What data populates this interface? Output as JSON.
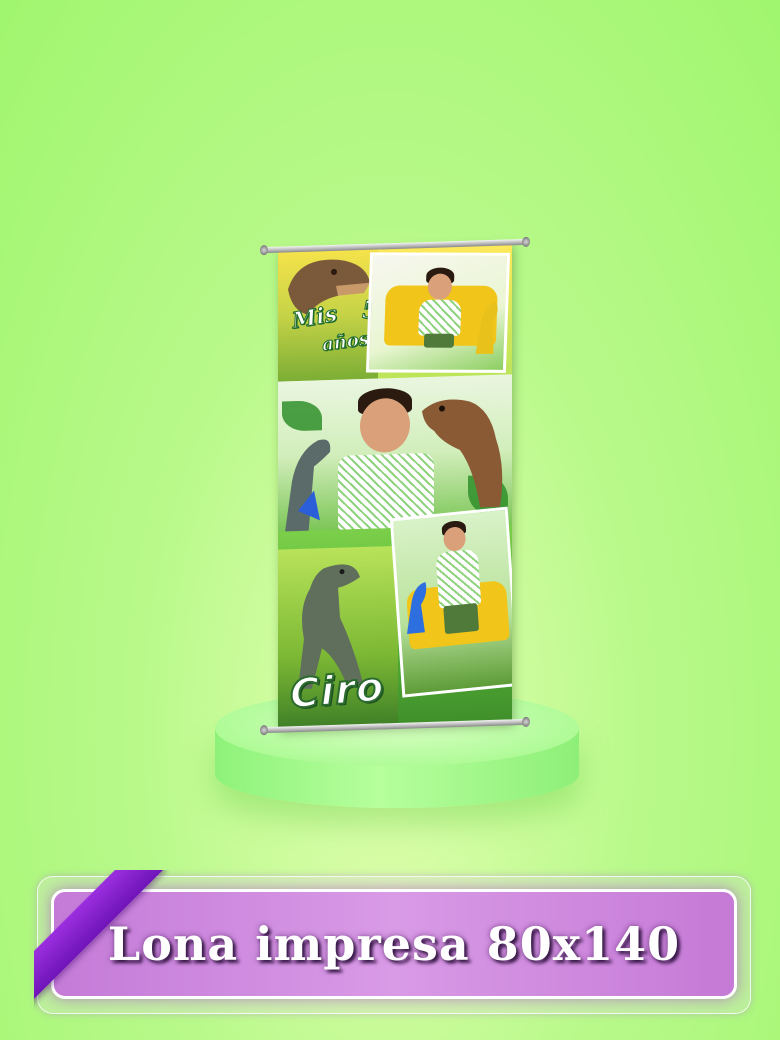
{
  "banner": {
    "text_mis": "Mis",
    "text_number": "5",
    "text_anos": "años",
    "name": "Ciro"
  },
  "caption": {
    "label": "Lona impresa 80x140"
  },
  "colors": {
    "background": "#b9f98b",
    "caption_fill": "#d99ae6",
    "ribbon": "#8a22d0",
    "name_stroke": "#2b6b2e"
  }
}
